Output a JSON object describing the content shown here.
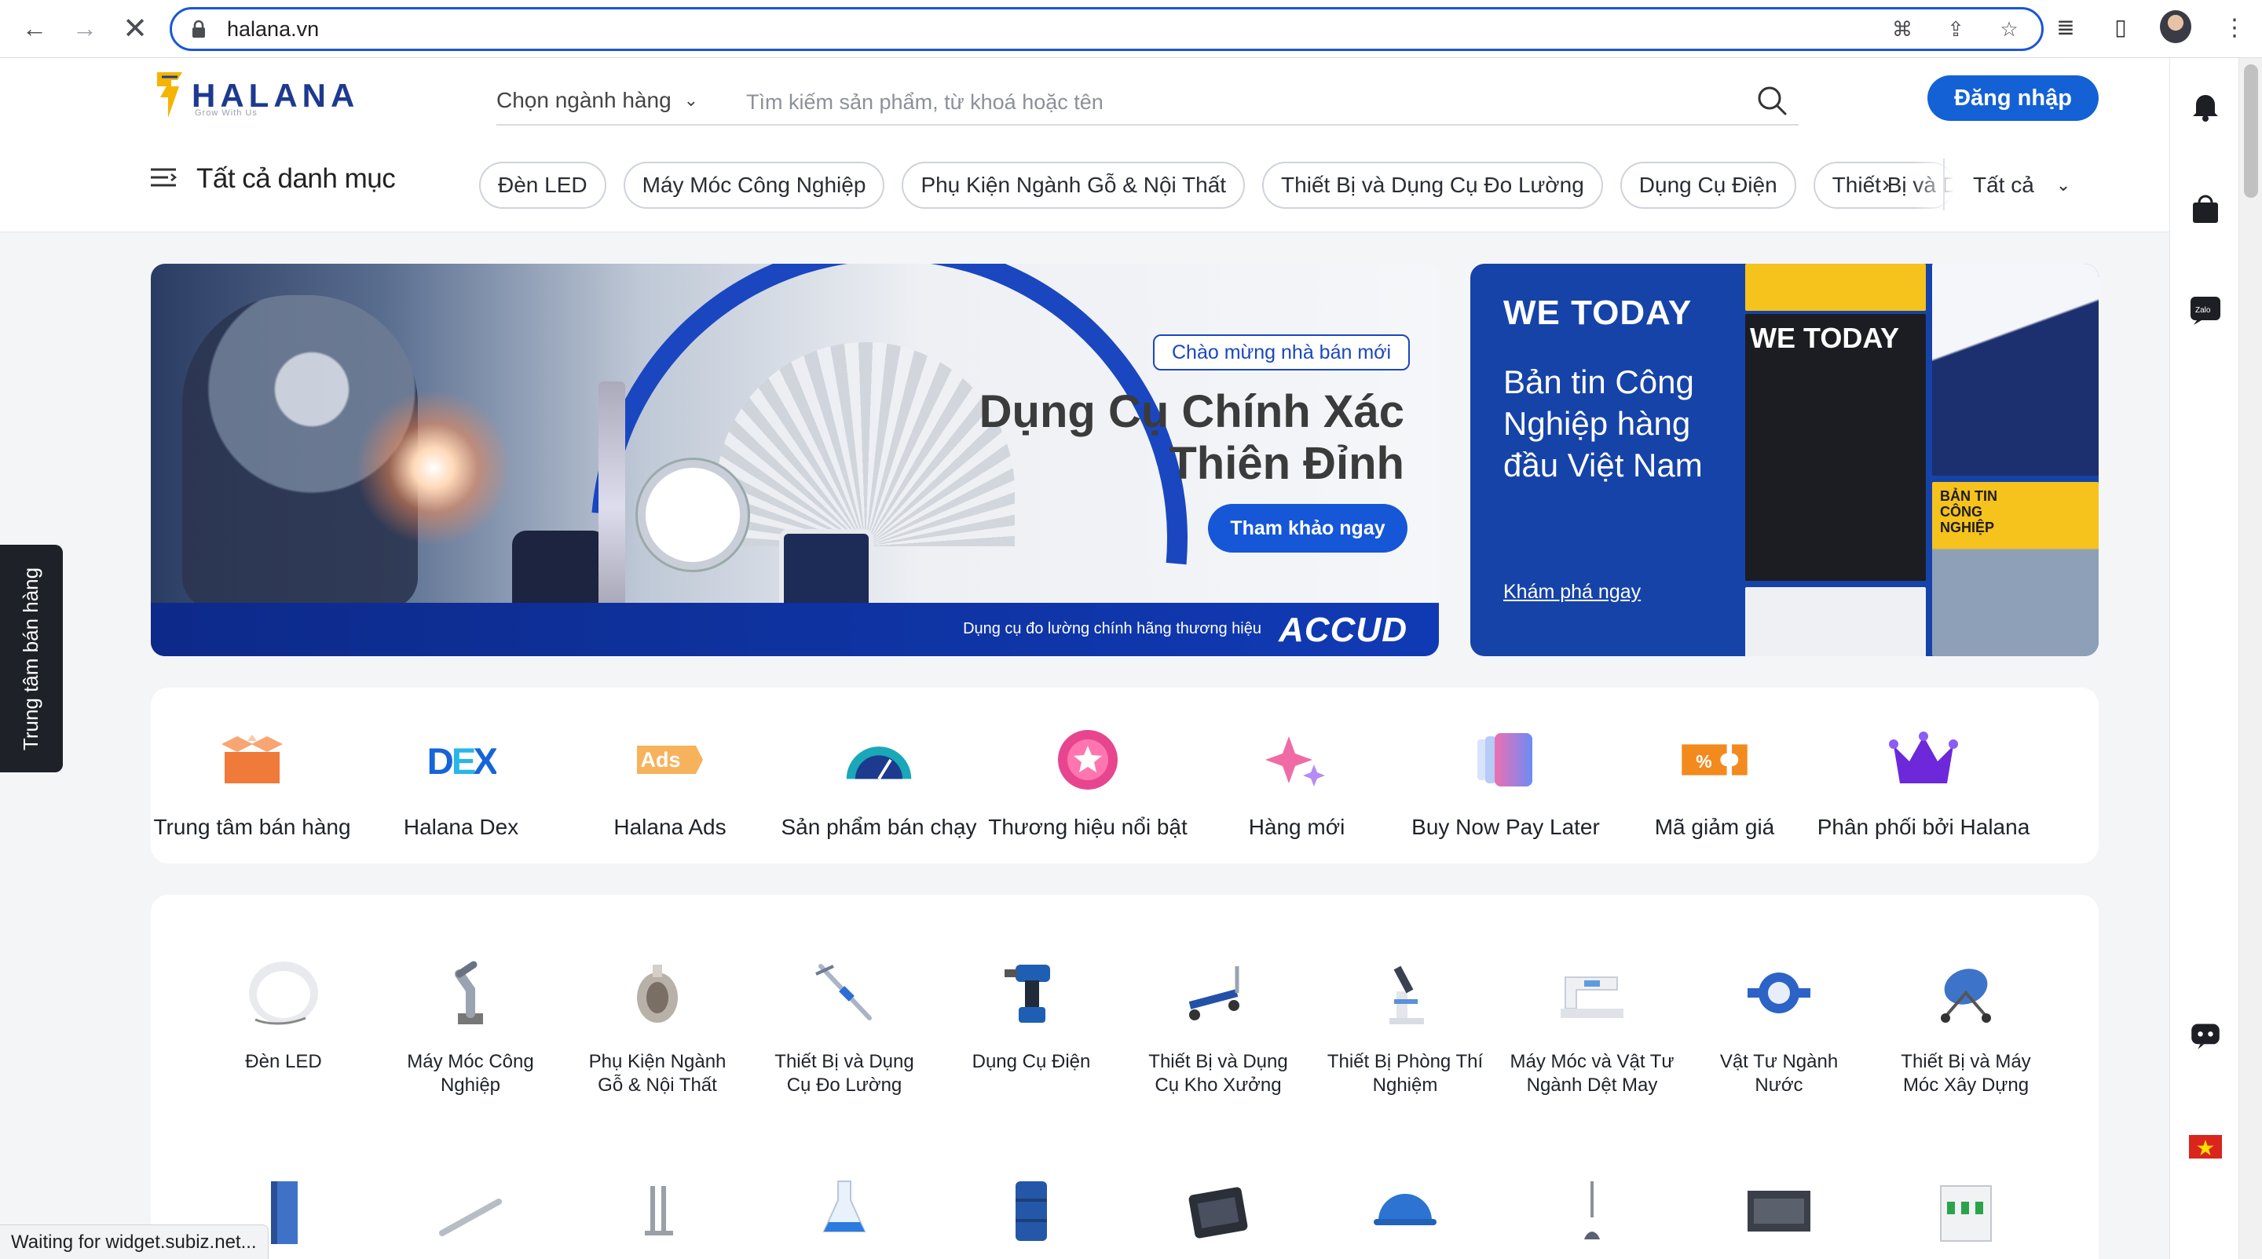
{
  "browser": {
    "url": "halana.vn",
    "status_text": "Waiting for widget.subiz.net..."
  },
  "header": {
    "logo_text": "HALANA",
    "logo_tagline": "Grow With Us",
    "category_select": "Chọn ngành hàng",
    "search_placeholder": "Tìm kiếm sản phẩm, từ khoá hoặc tên",
    "login_label": "Đăng nhập",
    "all_categories_label": "Tất cả danh mục",
    "chips": [
      "Đèn LED",
      "Máy Móc Công Nghiệp",
      "Phụ Kiện Ngành Gỗ & Nội Thất",
      "Thiết Bị và Dụng Cụ Đo Lường",
      "Dụng Cụ Điện",
      "Thiết Bị và D"
    ],
    "all_label": "Tất cả"
  },
  "banner_main": {
    "welcome": "Chào mừng nhà bán mới",
    "title_line1": "Dụng Cụ Chính Xác",
    "title_line2": "Thiên Đỉnh",
    "cta": "Tham khảo ngay",
    "footer_text": "Dụng cụ đo lường chính hãng thương hiệu",
    "brand": "ACCUD"
  },
  "banner_side": {
    "logo": "WE TODAY",
    "title": "Bản tin Công Nghiệp hàng đầu Việt Nam",
    "link": "Khám phá ngay",
    "mag_logo": "WE TODAY",
    "mag_tag": "BẢN TIN CÔNG NGHIỆP"
  },
  "features": [
    {
      "label": "Trung tâm bán hàng",
      "icon": "box-icon"
    },
    {
      "label": "Halana Dex",
      "icon": "dex-icon"
    },
    {
      "label": "Halana Ads",
      "icon": "ads-icon"
    },
    {
      "label": "Sản phẩm bán chạy",
      "icon": "gauge-icon"
    },
    {
      "label": "Thương hiệu nổi bật",
      "icon": "star-badge-icon"
    },
    {
      "label": "Hàng mới",
      "icon": "sparkle-icon"
    },
    {
      "label": "Buy Now Pay Later",
      "icon": "cards-icon"
    },
    {
      "label": "Mã giảm giá",
      "icon": "coupon-icon"
    },
    {
      "label": "Phân phối bởi Halana",
      "icon": "crown-icon"
    }
  ],
  "categories": [
    {
      "line1": "Đèn LED",
      "line2": ""
    },
    {
      "line1": "Máy Móc Công",
      "line2": "Nghiệp"
    },
    {
      "line1": "Phụ Kiện Ngành",
      "line2": "Gỗ & Nội Thất"
    },
    {
      "line1": "Thiết Bị và Dụng",
      "line2": "Cụ Đo Lường"
    },
    {
      "line1": "Dụng Cụ Điện",
      "line2": ""
    },
    {
      "line1": "Thiết Bị và Dụng",
      "line2": "Cụ Kho Xưởng"
    },
    {
      "line1": "Thiết Bị Phòng Thí",
      "line2": "Nghiệm"
    },
    {
      "line1": "Máy Móc và Vật Tư",
      "line2": "Ngành Dệt May"
    },
    {
      "line1": "Vật Tư Ngành",
      "line2": "Nước"
    },
    {
      "line1": "Thiết Bị và Máy",
      "line2": "Móc Xây Dựng"
    }
  ],
  "side_tab": "Trung tâm bán hàng",
  "colors": {
    "primary": "#1461d6",
    "brand_navy": "#1d3a8f",
    "banner_blue": "#1643a8"
  }
}
